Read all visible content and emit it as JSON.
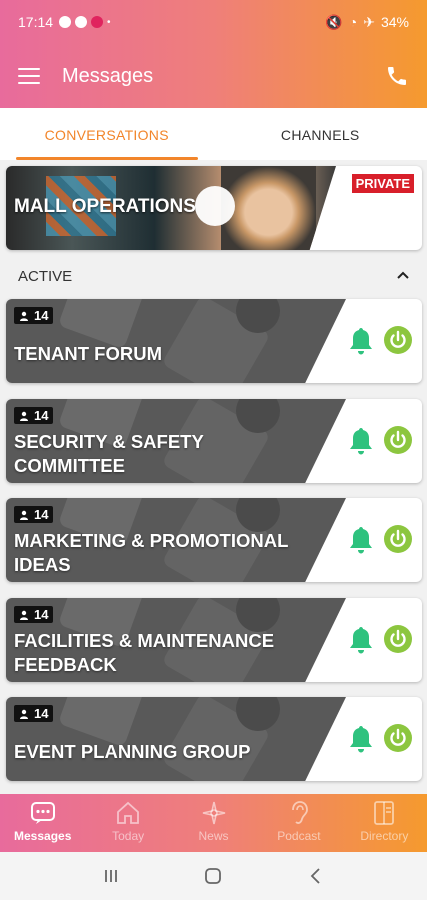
{
  "status_bar": {
    "time": "17:14",
    "battery": "34%"
  },
  "app_bar": {
    "title": "Messages"
  },
  "tabs": [
    {
      "label": "CONVERSATIONS"
    },
    {
      "label": "CHANNELS"
    }
  ],
  "private_channel": {
    "name": "MALL OPERATIONS",
    "badge": "PRIVATE"
  },
  "section": {
    "title": "ACTIVE"
  },
  "channels": [
    {
      "name": "TENANT FORUM",
      "members": "14"
    },
    {
      "name": "SECURITY & SAFETY COMMITTEE",
      "members": "14"
    },
    {
      "name": "MARKETING & PROMOTIONAL IDEAS",
      "members": "14"
    },
    {
      "name": "FACILITIES & MAINTENANCE FEEDBACK",
      "members": "14"
    },
    {
      "name": "EVENT PLANNING GROUP",
      "members": "14"
    }
  ],
  "bottom_nav": [
    {
      "label": "Messages",
      "icon": "messages-icon"
    },
    {
      "label": "Today",
      "icon": "home-icon"
    },
    {
      "label": "News",
      "icon": "news-icon"
    },
    {
      "label": "Podcast",
      "icon": "ear-icon"
    },
    {
      "label": "Directory",
      "icon": "directory-icon"
    }
  ],
  "colors": {
    "accent": "#f2852a",
    "bell": "#2ec27e",
    "power": "#8cc63f",
    "private": "#d81f2a"
  }
}
